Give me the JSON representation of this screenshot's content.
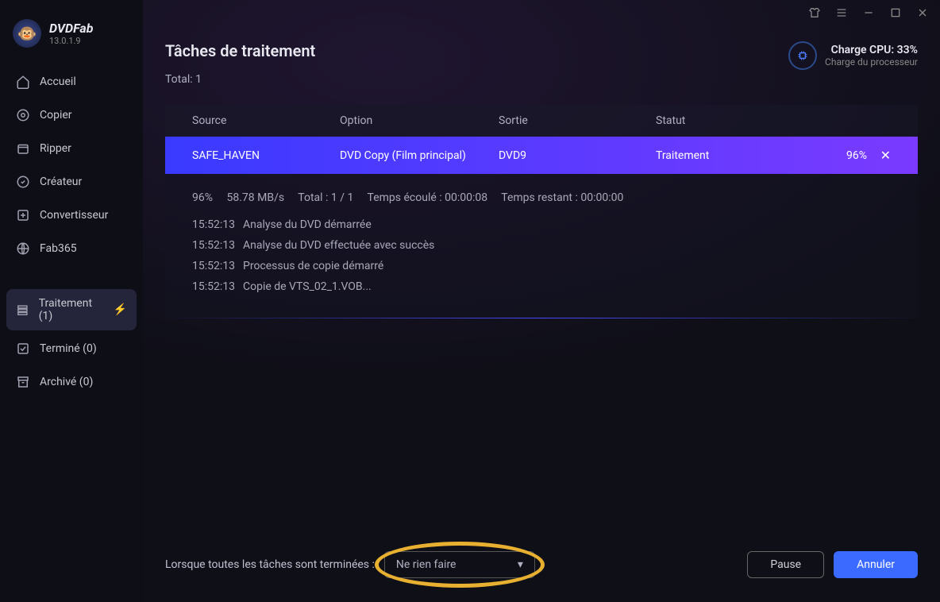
{
  "brand": {
    "name": "DVDFab",
    "version": "13.0.1.9"
  },
  "sidebar": {
    "items": [
      {
        "label": "Accueil",
        "icon": "home"
      },
      {
        "label": "Copier",
        "icon": "disc"
      },
      {
        "label": "Ripper",
        "icon": "box"
      },
      {
        "label": "Créateur",
        "icon": "edit"
      },
      {
        "label": "Convertisseur",
        "icon": "convert"
      },
      {
        "label": "Fab365",
        "icon": "globe"
      }
    ],
    "queue": [
      {
        "label": "Traitement (1)",
        "icon": "list",
        "active": true,
        "bolt": true
      },
      {
        "label": "Terminé (0)",
        "icon": "check"
      },
      {
        "label": "Archivé (0)",
        "icon": "archive"
      }
    ]
  },
  "page": {
    "title": "Tâches de traitement",
    "total_label": "Total: 1"
  },
  "cpu": {
    "line1": "Charge CPU: 33%",
    "line2": "Charge du processeur"
  },
  "columns": {
    "source": "Source",
    "option": "Option",
    "sortie": "Sortie",
    "statut": "Statut"
  },
  "task": {
    "source": "SAFE_HAVEN",
    "option": "DVD Copy (Film principal)",
    "sortie": "DVD9",
    "statut": "Traitement",
    "percent": "96%"
  },
  "stats": {
    "pct": "96%",
    "speed": "58.78 MB/s",
    "total": "Total : 1 / 1",
    "elapsed": "Temps écoulé : 00:00:08",
    "remaining": "Temps restant : 00:00:00"
  },
  "log": [
    {
      "time": "15:52:13",
      "msg": "Analyse du DVD démarrée"
    },
    {
      "time": "15:52:13",
      "msg": "Analyse du DVD effectuée avec succès"
    },
    {
      "time": "15:52:13",
      "msg": "Processus de copie démarré"
    },
    {
      "time": "15:52:13",
      "msg": "Copie de VTS_02_1.VOB..."
    }
  ],
  "footer": {
    "label": "Lorsque toutes les tâches sont terminées :",
    "dropdown": "Ne rien faire",
    "pause": "Pause",
    "cancel": "Annuler"
  }
}
